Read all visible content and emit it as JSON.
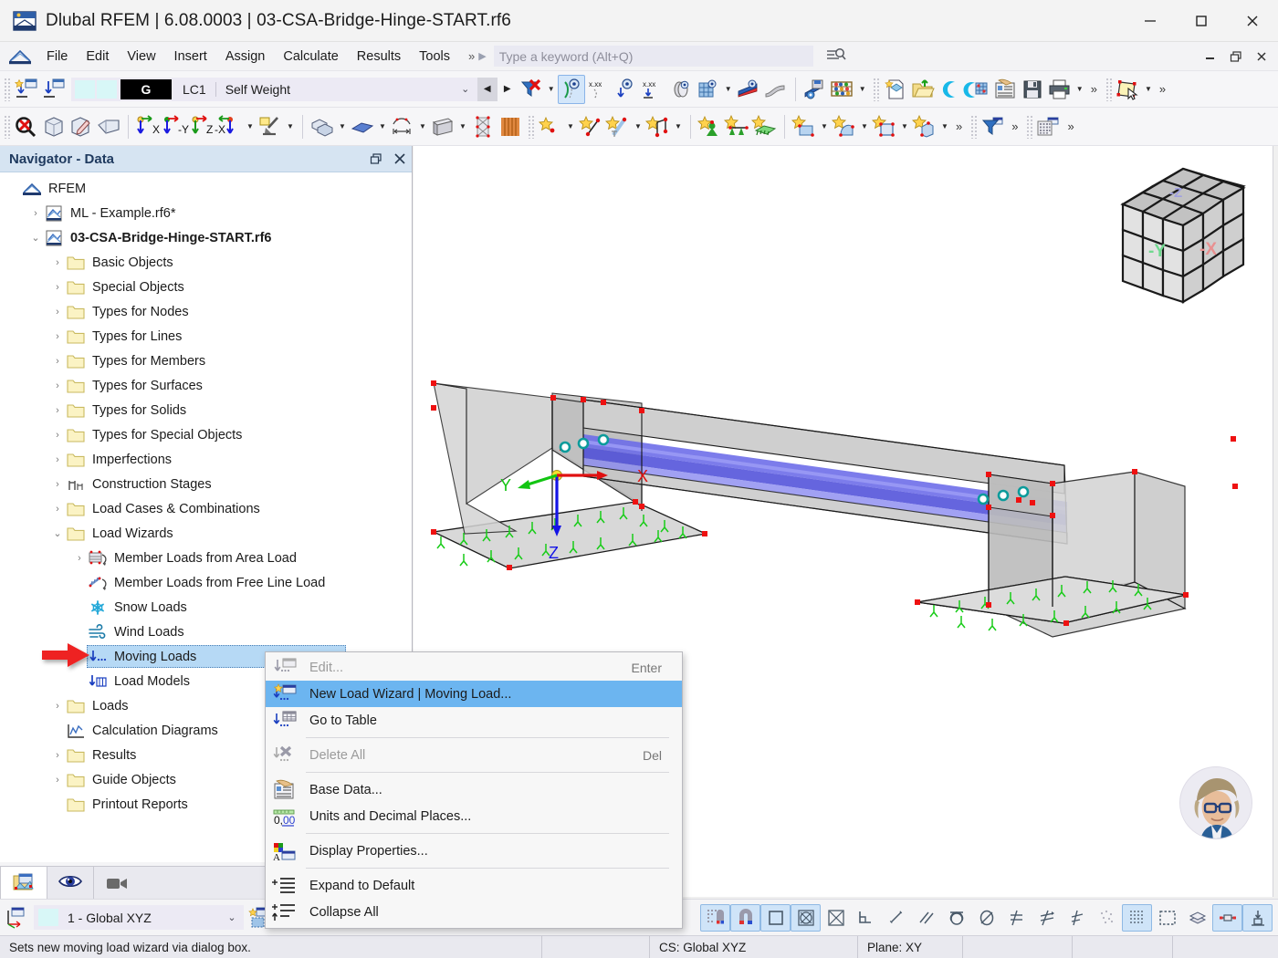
{
  "window": {
    "title": "Dlubal RFEM | 6.08.0003 | 03-CSA-Bridge-Hinge-START.rf6",
    "app_icon": "rfem-logo-icon",
    "minimize": "—",
    "maximize": "☐",
    "close": "✕"
  },
  "menubar": {
    "items": [
      "File",
      "Edit",
      "View",
      "Insert",
      "Assign",
      "Calculate",
      "Results",
      "Tools"
    ],
    "overflow": "»",
    "play": "▶",
    "search_placeholder": "Type a keyword (Alt+Q)",
    "search_icon": "search-list-icon",
    "doc_minimize": "–",
    "doc_restore": "❐",
    "doc_close": "✕"
  },
  "loadcase": {
    "g_badge": "G",
    "id": "LC1",
    "name": "Self Weight",
    "dropdown_caret": "⌄",
    "prev": "◀",
    "next": "▶"
  },
  "navigator": {
    "title": "Navigator - Data",
    "restore_icon": "restore-panel-icon",
    "close_icon": "close-icon",
    "tree": [
      {
        "label": "RFEM",
        "level": 0,
        "expander": "",
        "icon": "rfem-root-icon",
        "bold": false
      },
      {
        "label": "ML - Example.rf6*",
        "level": 1,
        "expander": "›",
        "icon": "model-file-icon",
        "bold": false
      },
      {
        "label": "03-CSA-Bridge-Hinge-START.rf6",
        "level": 1,
        "expander": "⌄",
        "icon": "model-file-icon",
        "bold": true
      },
      {
        "label": "Basic Objects",
        "level": 2,
        "expander": "›",
        "icon": "folder-icon",
        "bold": false
      },
      {
        "label": "Special Objects",
        "level": 2,
        "expander": "›",
        "icon": "folder-icon",
        "bold": false
      },
      {
        "label": "Types for Nodes",
        "level": 2,
        "expander": "›",
        "icon": "folder-icon",
        "bold": false
      },
      {
        "label": "Types for Lines",
        "level": 2,
        "expander": "›",
        "icon": "folder-icon",
        "bold": false
      },
      {
        "label": "Types for Members",
        "level": 2,
        "expander": "›",
        "icon": "folder-icon",
        "bold": false
      },
      {
        "label": "Types for Surfaces",
        "level": 2,
        "expander": "›",
        "icon": "folder-icon",
        "bold": false
      },
      {
        "label": "Types for Solids",
        "level": 2,
        "expander": "›",
        "icon": "folder-icon",
        "bold": false
      },
      {
        "label": "Types for Special Objects",
        "level": 2,
        "expander": "›",
        "icon": "folder-icon",
        "bold": false
      },
      {
        "label": "Imperfections",
        "level": 2,
        "expander": "›",
        "icon": "folder-icon",
        "bold": false
      },
      {
        "label": "Construction Stages",
        "level": 2,
        "expander": "›",
        "icon": "construction-stages-icon",
        "bold": false
      },
      {
        "label": "Load Cases & Combinations",
        "level": 2,
        "expander": "›",
        "icon": "folder-icon",
        "bold": false
      },
      {
        "label": "Load Wizards",
        "level": 2,
        "expander": "⌄",
        "icon": "folder-icon",
        "bold": false
      },
      {
        "label": "Member Loads from Area Load",
        "level": 3,
        "expander": "›",
        "icon": "member-loads-area-icon",
        "bold": false
      },
      {
        "label": "Member Loads from Free Line Load",
        "level": 3,
        "expander": "",
        "icon": "member-loads-line-icon",
        "bold": false
      },
      {
        "label": "Snow Loads",
        "level": 3,
        "expander": "",
        "icon": "snow-icon",
        "bold": false
      },
      {
        "label": "Wind Loads",
        "level": 3,
        "expander": "",
        "icon": "wind-icon",
        "bold": false
      },
      {
        "label": "Moving Loads",
        "level": 3,
        "expander": "",
        "icon": "moving-loads-icon",
        "bold": false,
        "selected": true
      },
      {
        "label": "Load Models",
        "level": 3,
        "expander": "",
        "icon": "load-models-icon",
        "bold": false
      },
      {
        "label": "Loads",
        "level": 2,
        "expander": "›",
        "icon": "folder-icon",
        "bold": false
      },
      {
        "label": "Calculation Diagrams",
        "level": 2,
        "expander": "",
        "icon": "calculation-diagram-icon",
        "bold": false
      },
      {
        "label": "Results",
        "level": 2,
        "expander": "›",
        "icon": "folder-icon",
        "bold": false
      },
      {
        "label": "Guide Objects",
        "level": 2,
        "expander": "›",
        "icon": "folder-icon",
        "bold": false
      },
      {
        "label": "Printout Reports",
        "level": 2,
        "expander": "",
        "icon": "folder-icon",
        "bold": false
      }
    ]
  },
  "context_menu": {
    "items": [
      {
        "label": "Edit...",
        "shortcut": "Enter",
        "icon": "edit-moving-load-icon",
        "state": "disabled"
      },
      {
        "label": "New Load Wizard | Moving Load...",
        "shortcut": "",
        "icon": "new-load-wizard-icon",
        "state": "highlight"
      },
      {
        "label": "Go to Table",
        "shortcut": "",
        "icon": "go-to-table-icon",
        "state": "normal"
      },
      {
        "separator": true
      },
      {
        "label": "Delete All",
        "shortcut": "Del",
        "icon": "delete-all-icon",
        "state": "disabled"
      },
      {
        "separator": true
      },
      {
        "label": "Base Data...",
        "shortcut": "",
        "icon": "base-data-icon",
        "state": "normal"
      },
      {
        "label": "Units and Decimal Places...",
        "shortcut": "",
        "icon": "units-decimals-icon",
        "state": "normal"
      },
      {
        "separator": true
      },
      {
        "label": "Display Properties...",
        "shortcut": "",
        "icon": "display-properties-icon",
        "state": "normal"
      },
      {
        "separator": true
      },
      {
        "label": "Expand to Default",
        "shortcut": "",
        "icon": "expand-to-default-icon",
        "state": "normal"
      },
      {
        "label": "Collapse All",
        "shortcut": "",
        "icon": "collapse-all-icon",
        "state": "normal"
      }
    ]
  },
  "viewport": {
    "axes": {
      "x": "X",
      "y": "Y",
      "z": "Z"
    },
    "viewcube": {
      "face_left": "-Y",
      "face_right": "-X",
      "face_top": "-Z"
    },
    "model_colors": {
      "surface_fill": "#d0d0d0",
      "member_highlight": "#4a4ae0",
      "node_marker": "#ee1111",
      "support_marker": "#16c716",
      "hinge_marker": "#0c9b9b",
      "axis_x": "#e01010",
      "axis_y": "#12c512",
      "axis_z": "#1414e6"
    }
  },
  "coordinate_system": {
    "value": "1 - Global XYZ",
    "dropdown_caret": "⌄",
    "new_cs_icon": "new-coordinate-system-icon"
  },
  "panel_tabs": [
    {
      "name": "project-navigator-tab",
      "icon": "project-folder-icon",
      "active": true
    },
    {
      "name": "display-navigator-tab",
      "icon": "eye-icon",
      "active": false
    },
    {
      "name": "views-navigator-tab",
      "icon": "camera-icon",
      "active": false
    }
  ],
  "statusbar": {
    "hint": "Sets new moving load wizard via dialog box.",
    "cs": "CS: Global XYZ",
    "plane": "Plane: XY"
  },
  "snap_toolbar": [
    {
      "name": "snap-grid-icon",
      "on": true
    },
    {
      "name": "object-snap-icon",
      "on": true
    },
    {
      "name": "snap-orthogonal-icon",
      "on": true
    },
    {
      "name": "snap-center-icon",
      "on": true
    },
    {
      "name": "snap-node-icon",
      "on": false
    },
    {
      "name": "snap-corner-icon",
      "on": false
    },
    {
      "name": "snap-line-icon",
      "on": false
    },
    {
      "name": "snap-parallel-icon",
      "on": false
    },
    {
      "name": "snap-arc-icon",
      "on": false
    },
    {
      "name": "snap-tangent-icon",
      "on": false
    },
    {
      "name": "snap-perp-1-icon",
      "on": false
    },
    {
      "name": "snap-perp-2-icon",
      "on": false
    },
    {
      "name": "snap-perp-3-icon",
      "on": false
    },
    {
      "name": "snap-points-icon",
      "on": false
    },
    {
      "name": "grid-visible-icon",
      "on": true
    },
    {
      "name": "selection-frame-icon",
      "on": false
    },
    {
      "name": "layers-icon",
      "on": false
    },
    {
      "name": "member-view-icon",
      "on": true
    },
    {
      "name": "support-view-icon",
      "on": true
    }
  ]
}
